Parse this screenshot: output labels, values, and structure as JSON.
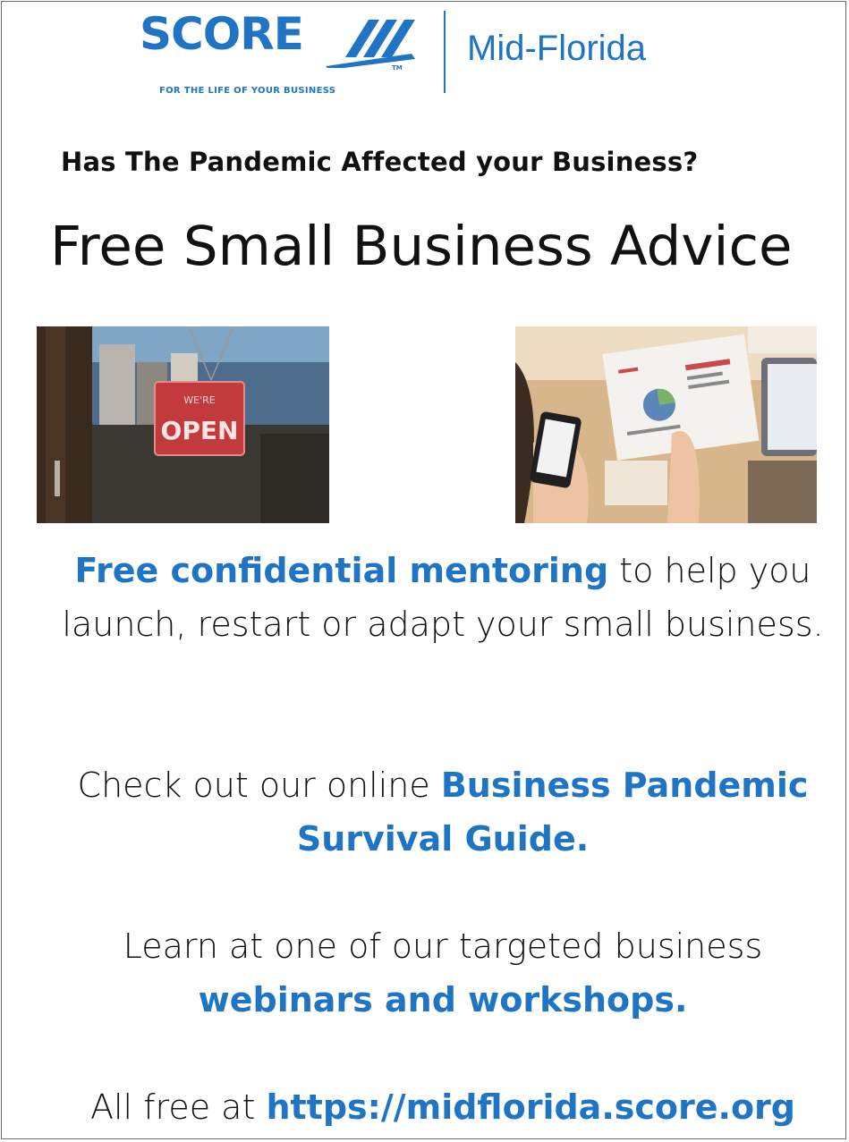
{
  "logo": {
    "wordmark": "SCORE",
    "tm": "TM",
    "tagline": "FOR THE LIFE OF YOUR BUSINESS",
    "region": "Mid-Florida"
  },
  "question": "Has The Pandemic Affected your Business?",
  "headline": "Free  Small Business Advice",
  "images": {
    "left_sign_text_top": "WE'RE",
    "left_sign_text": "OPEN"
  },
  "paragraphs": {
    "p1": {
      "highlight": "Free confidential mentoring",
      "rest": " to help you launch, restart or adapt your small business."
    },
    "p2": {
      "lead": "Check out our online ",
      "highlight": "Business  Pandemic Survival Guide."
    },
    "p3": {
      "lead": "Learn at one of our targeted business ",
      "highlight": "webinars and workshops."
    },
    "p4": {
      "lead": "All free at ",
      "highlight": "https://midflorida.score.org"
    }
  },
  "colors": {
    "brand_blue": "#1f75c4",
    "text": "#111111"
  }
}
